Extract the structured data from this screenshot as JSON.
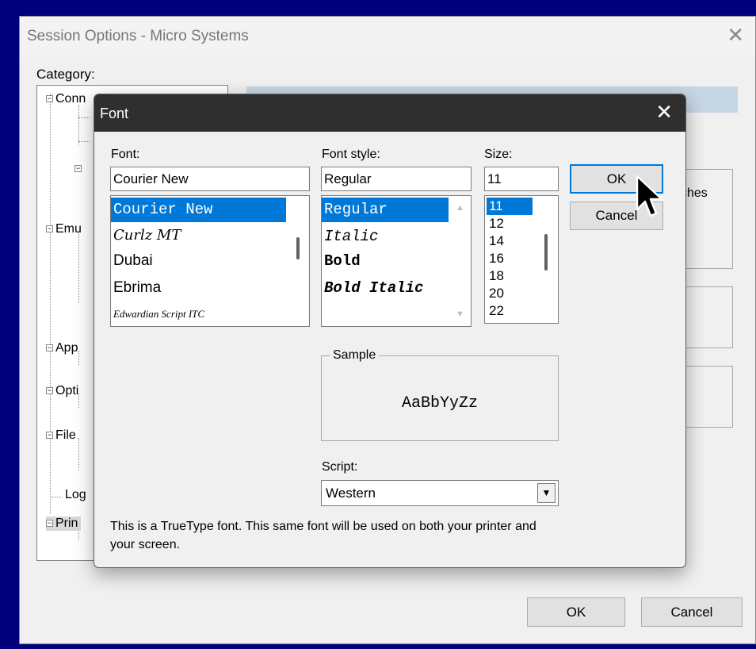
{
  "outer": {
    "title": "Session Options - Micro Systems",
    "category_label": "Category:",
    "tree_items": [
      "Conn",
      "Emu",
      "App",
      "Opti",
      "File",
      "Log",
      "Prin"
    ],
    "right_group_text": "ches",
    "ok_label": "OK",
    "cancel_label": "Cancel"
  },
  "font_dialog": {
    "title": "Font",
    "font_label": "Font:",
    "font_value": "Courier New",
    "fonts": [
      "Courier New",
      "Curlz MT",
      "Dubai",
      "Ebrima",
      "Edwardian Script ITC"
    ],
    "style_label": "Font style:",
    "style_value": "Regular",
    "styles": [
      "Regular",
      "Italic",
      "Bold",
      "Bold Italic"
    ],
    "size_label": "Size:",
    "size_value": "11",
    "sizes": [
      "11",
      "12",
      "14",
      "16",
      "18",
      "20",
      "22"
    ],
    "ok_label": "OK",
    "cancel_label": "Cancel",
    "sample_label": "Sample",
    "sample_text": "AaBbYyZz",
    "script_label": "Script:",
    "script_value": "Western",
    "description": "This is a TrueType font. This same font will be used on both your printer and your screen."
  },
  "colors": {
    "desktop": "#00007b",
    "selection": "#0078d7",
    "dialog_titlebar": "#2f2f2f",
    "banner": "#c7d6e4"
  },
  "icons": [
    "close-icon",
    "dropdown-arrow-icon",
    "scroll-up-icon",
    "scroll-down-icon",
    "mouse-pointer-icon",
    "tree-collapse-icon"
  ]
}
